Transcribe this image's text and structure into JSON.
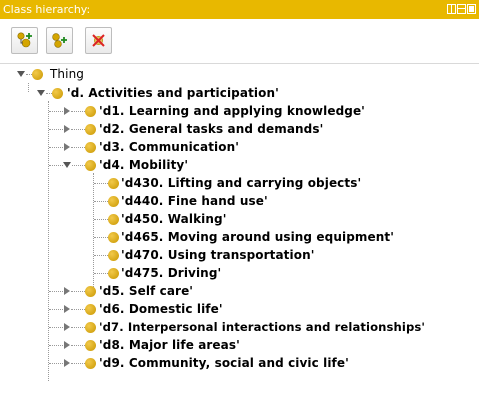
{
  "panel": {
    "title": "Class hierarchy:",
    "accent": "#e8b800"
  },
  "toolbar": {
    "buttons": [
      {
        "icon": "add-subclass-icon"
      },
      {
        "icon": "add-sibling-icon"
      },
      {
        "icon": "delete-class-icon"
      }
    ]
  },
  "tree": {
    "root": "Thing",
    "d": "'d. Activities and participation'",
    "d1": "'d1. Learning and applying knowledge'",
    "d2": "'d2. General tasks and demands'",
    "d3": "'d3. Communication'",
    "d4": "'d4. Mobility'",
    "d430": "'d430. Lifting and carrying objects'",
    "d440": "'d440. Fine hand use'",
    "d450": "'d450. Walking'",
    "d465": "'d465. Moving around using equipment'",
    "d470": "'d470. Using transportation'",
    "d475": "'d475. Driving'",
    "d5": "'d5. Self care'",
    "d6": "'d6. Domestic life'",
    "d7": "'d7. Interpersonal interactions and relationships'",
    "d8": "'d8. Major life areas'",
    "d9": "'d9. Community, social and civic life'"
  }
}
